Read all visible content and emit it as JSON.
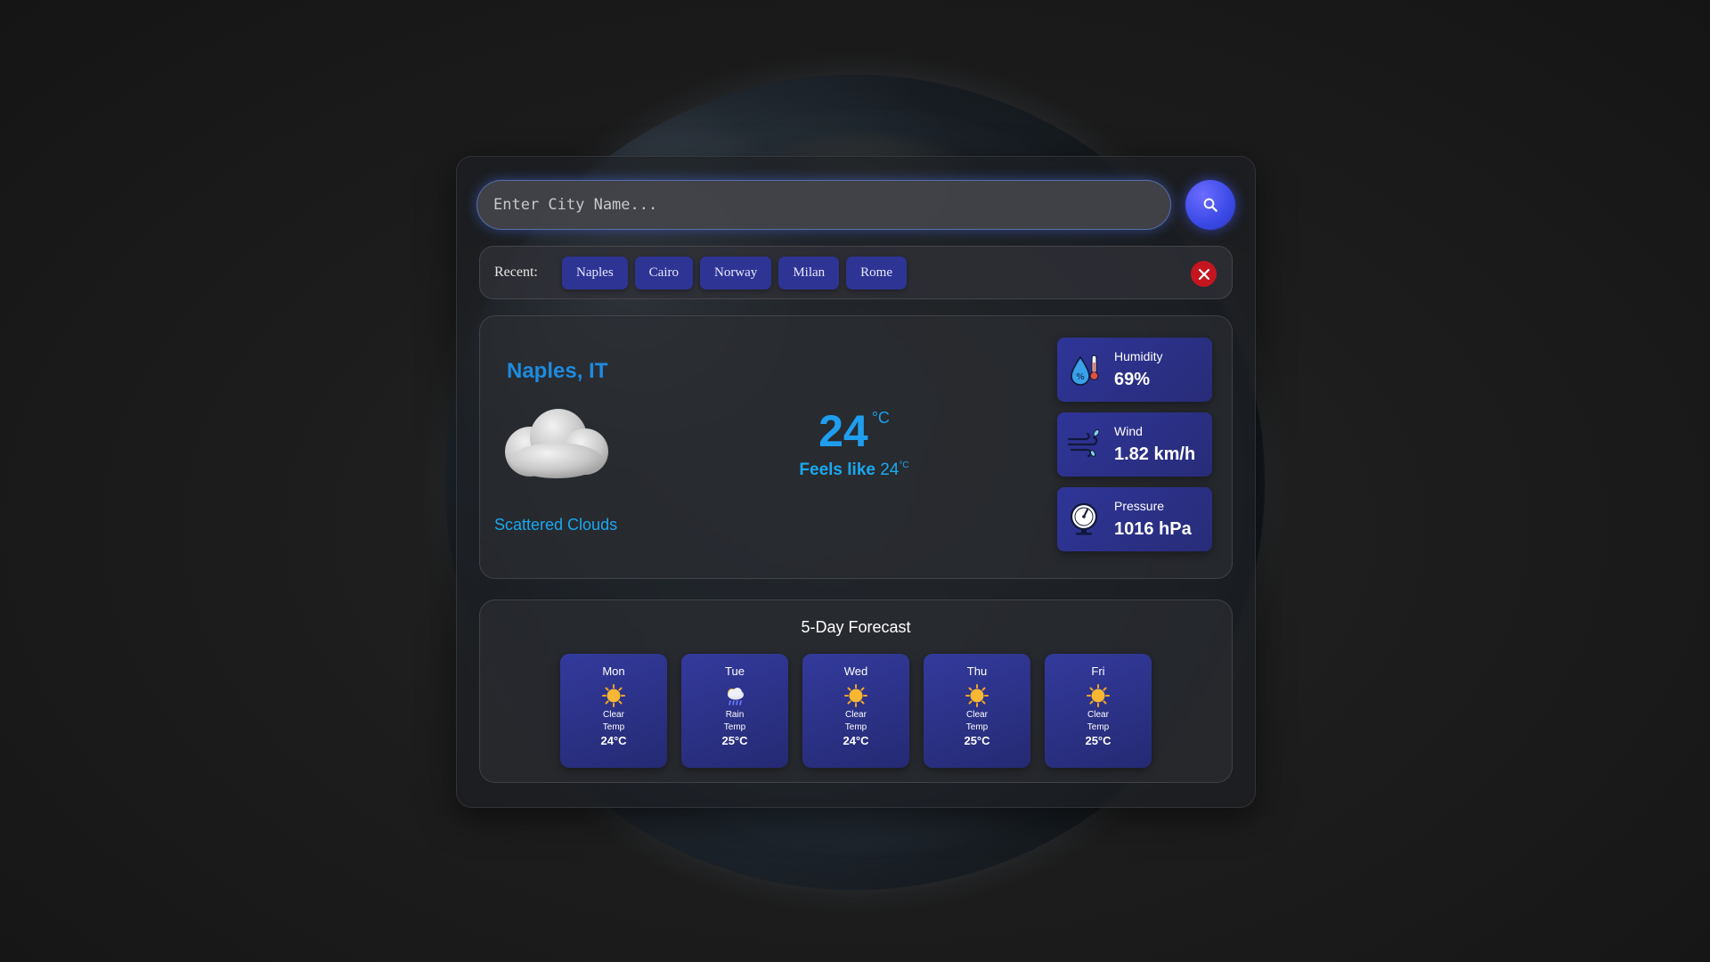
{
  "search": {
    "placeholder": "Enter City Name...",
    "button_icon": "search-icon"
  },
  "recent": {
    "label": "Recent:",
    "items": [
      "Naples",
      "Cairo",
      "Norway",
      "Milan",
      "Rome"
    ],
    "clear_icon": "close-icon"
  },
  "current": {
    "city": "Naples, IT",
    "condition": "Scattered Clouds",
    "condition_icon": "cloud-icon",
    "temp": "24",
    "temp_unit": "°C",
    "feels_like_label": "Feels like",
    "feels_like_value": "24",
    "feels_like_unit": "°C"
  },
  "stats": [
    {
      "label": "Humidity",
      "value": "69%",
      "icon": "humidity-icon"
    },
    {
      "label": "Wind",
      "value": "1.82 km/h",
      "icon": "wind-icon"
    },
    {
      "label": "Pressure",
      "value": "1016 hPa",
      "icon": "pressure-gauge-icon"
    }
  ],
  "forecast": {
    "title": "5-Day Forecast",
    "days": [
      {
        "day": "Mon",
        "condition": "Clear",
        "temp_label": "Temp",
        "temp": "24°C",
        "icon": "sun-icon"
      },
      {
        "day": "Tue",
        "condition": "Rain",
        "temp_label": "Temp",
        "temp": "25°C",
        "icon": "rain-cloud-icon"
      },
      {
        "day": "Wed",
        "condition": "Clear",
        "temp_label": "Temp",
        "temp": "24°C",
        "icon": "sun-icon"
      },
      {
        "day": "Thu",
        "condition": "Clear",
        "temp_label": "Temp",
        "temp": "25°C",
        "icon": "sun-icon"
      },
      {
        "day": "Fri",
        "condition": "Clear",
        "temp_label": "Temp",
        "temp": "25°C",
        "icon": "sun-icon"
      }
    ]
  },
  "colors": {
    "accent_blue": "#1f9ef0",
    "chip_bg": "#2e3494",
    "card_bg": "#2f3598",
    "clear_red": "#c5161f",
    "search_button": "#3b49e6"
  }
}
